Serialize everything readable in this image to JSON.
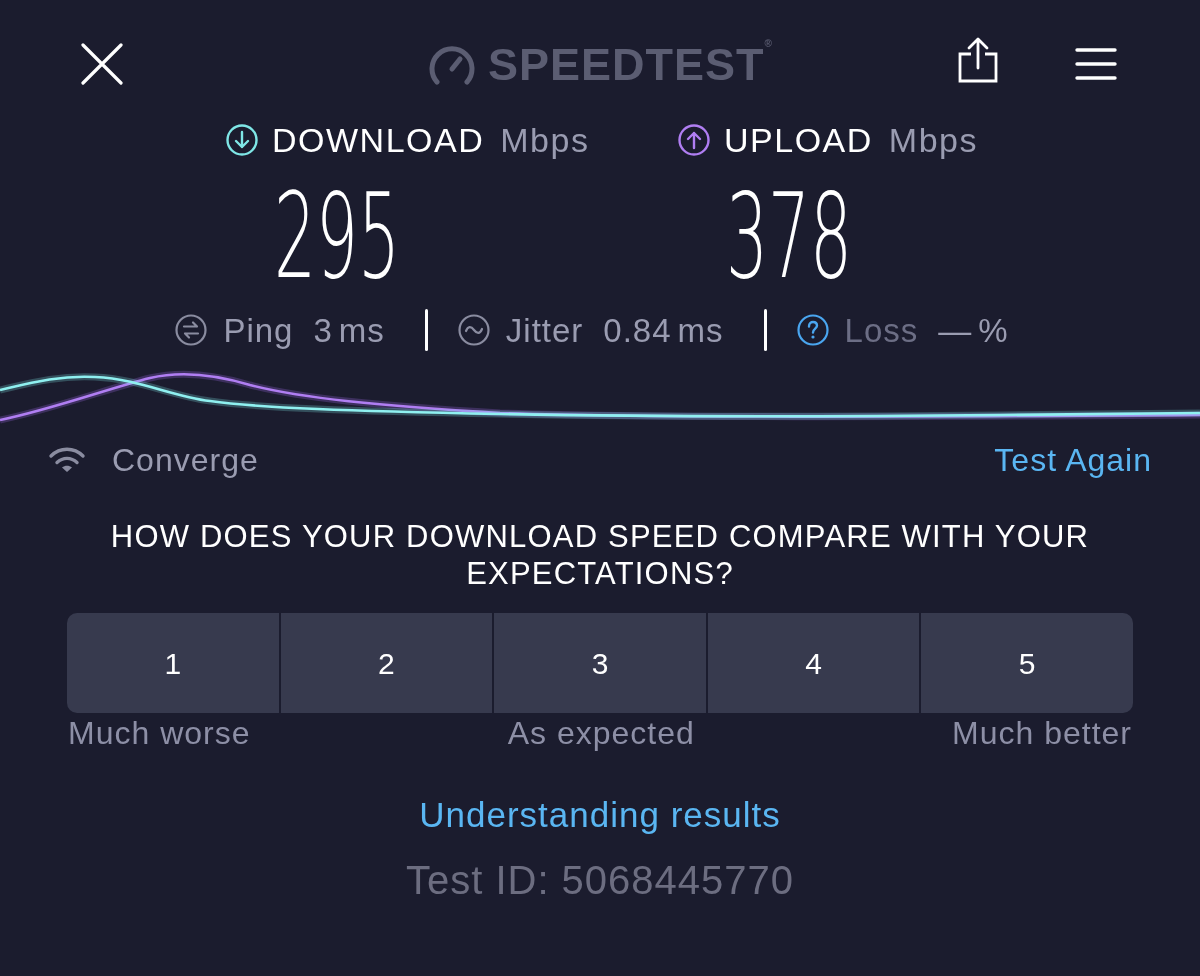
{
  "header": {
    "logo": "SPEEDTEST$^{®}$"
  },
  "results": [
    {
      "kind": "download",
      "label": "DOWNLOAD",
      "unit": "Mbps",
      "value": "295"
    },
    {
      "kind": "upload",
      "label": "UPLOAD",
      "unit": "Mbps",
      "value": "378"
    }
  ],
  "stats": [
    {
      "kind": "ping",
      "label": "Ping",
      "value": "3",
      "unit": "ms",
      "disabled": false
    },
    {
      "kind": "jitter",
      "label": "Jitter",
      "value": "0.84",
      "unit": "ms",
      "disabled": false
    },
    {
      "kind": "loss",
      "label": "Loss",
      "value": "—",
      "unit": "%",
      "disabled": true
    }
  ],
  "connection": {
    "provider": "Converge",
    "action": "Test Again"
  },
  "survey": {
    "question": "HOW DOES YOUR DOWNLOAD SPEED COMPARE WITH YOUR EXPECTATIONS?",
    "options": [
      {
        "label": "1",
        "selected": false
      },
      {
        "label": "2",
        "selected": false
      },
      {
        "label": "3",
        "selected": false
      },
      {
        "label": "4",
        "selected": false
      },
      {
        "label": "5",
        "selected": false
      }
    ],
    "scale_labels": [
      "Much worse",
      "As expected",
      "Much better"
    ]
  },
  "footer": {
    "link": "Understanding results",
    "test_id": "Test ID: 5068445770"
  }
}
